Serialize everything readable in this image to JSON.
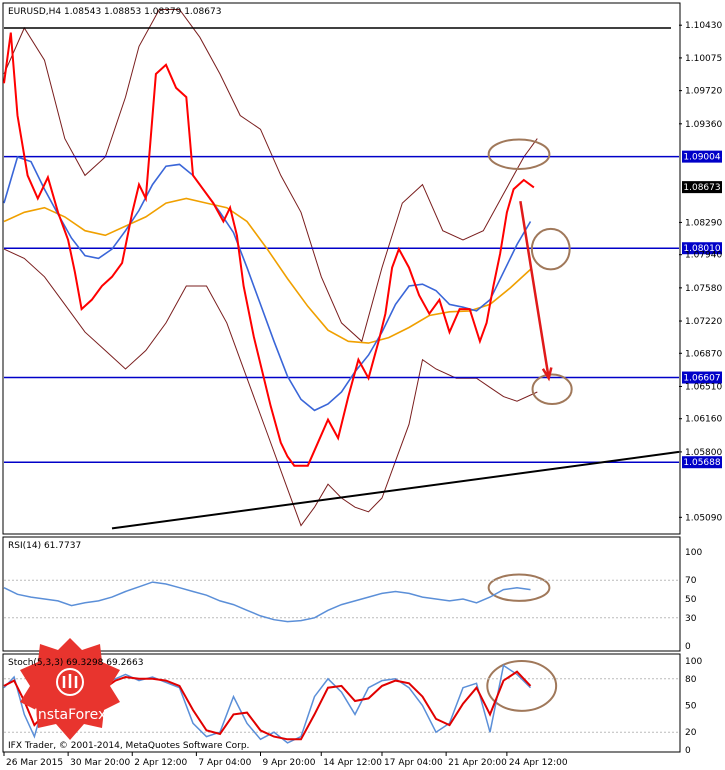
{
  "chart_data": {
    "type": "line",
    "colors": {
      "price": "#ff0000",
      "ma_fast": "#3a66d8",
      "ma_slow": "#f0a000",
      "bands": "#7a1e1e",
      "levels": "#0000c8",
      "trend": "#000000",
      "annotation_circle": "#a0785a",
      "annotation_arrow": "#e01a1a",
      "rsi": "#5b8fd8",
      "stoch_main": "#5b8fd8",
      "stoch_signal": "#e00000"
    },
    "main": {
      "header": "EURUSD,H4  1.08543 1.08853 1.08379 1.08673",
      "ylim": [
        1.0492,
        1.1066
      ],
      "y_ticks": [
        "1.10430",
        "1.10075",
        "1.09720",
        "1.09360",
        "1.08290",
        "1.07940",
        "1.07580",
        "1.07220",
        "1.06870",
        "1.06510",
        "1.06160",
        "1.05800",
        "1.05090"
      ],
      "levels": [
        {
          "value": 1.09004,
          "label": "1.09004"
        },
        {
          "value": 1.0801,
          "label": "1.08010"
        },
        {
          "value": 1.06607,
          "label": "1.06607"
        },
        {
          "value": 1.05688,
          "label": "1.05688"
        }
      ],
      "current_price": {
        "value": 1.08673,
        "label": "1.08673"
      },
      "top_line": 1.104,
      "trendline": [
        [
          0.16,
          1.0497
        ],
        [
          1.0,
          1.058
        ]
      ],
      "price": [
        [
          0.0,
          1.098
        ],
        [
          0.01,
          1.1035
        ],
        [
          0.02,
          1.0945
        ],
        [
          0.035,
          1.088
        ],
        [
          0.05,
          1.0855
        ],
        [
          0.065,
          1.0878
        ],
        [
          0.08,
          1.084
        ],
        [
          0.095,
          1.081
        ],
        [
          0.105,
          1.0775
        ],
        [
          0.115,
          1.0735
        ],
        [
          0.13,
          1.0745
        ],
        [
          0.145,
          1.076
        ],
        [
          0.16,
          1.077
        ],
        [
          0.175,
          1.0785
        ],
        [
          0.19,
          1.084
        ],
        [
          0.2,
          1.087
        ],
        [
          0.21,
          1.0855
        ],
        [
          0.225,
          1.099
        ],
        [
          0.24,
          1.1
        ],
        [
          0.255,
          1.0975
        ],
        [
          0.27,
          1.0965
        ],
        [
          0.28,
          1.088
        ],
        [
          0.295,
          1.0865
        ],
        [
          0.31,
          1.085
        ],
        [
          0.325,
          1.083
        ],
        [
          0.335,
          1.0845
        ],
        [
          0.345,
          1.0815
        ],
        [
          0.355,
          1.076
        ],
        [
          0.37,
          1.0705
        ],
        [
          0.385,
          1.066
        ],
        [
          0.395,
          1.063
        ],
        [
          0.41,
          1.059
        ],
        [
          0.42,
          1.0575
        ],
        [
          0.43,
          1.0565
        ],
        [
          0.45,
          1.0565
        ],
        [
          0.465,
          1.059
        ],
        [
          0.48,
          1.0615
        ],
        [
          0.495,
          1.0595
        ],
        [
          0.51,
          1.064
        ],
        [
          0.525,
          1.068
        ],
        [
          0.54,
          1.066
        ],
        [
          0.555,
          1.07
        ],
        [
          0.565,
          1.073
        ],
        [
          0.575,
          1.078
        ],
        [
          0.585,
          1.08
        ],
        [
          0.6,
          1.078
        ],
        [
          0.615,
          1.075
        ],
        [
          0.63,
          1.073
        ],
        [
          0.645,
          1.0745
        ],
        [
          0.66,
          1.071
        ],
        [
          0.675,
          1.0735
        ],
        [
          0.69,
          1.0735
        ],
        [
          0.705,
          1.07
        ],
        [
          0.715,
          1.072
        ],
        [
          0.725,
          1.076
        ],
        [
          0.735,
          1.0795
        ],
        [
          0.745,
          1.084
        ],
        [
          0.755,
          1.0865
        ],
        [
          0.77,
          1.0875
        ],
        [
          0.785,
          1.0867
        ]
      ],
      "ma_fast": [
        [
          0.0,
          1.085
        ],
        [
          0.02,
          1.09
        ],
        [
          0.04,
          1.0895
        ],
        [
          0.06,
          1.0865
        ],
        [
          0.08,
          1.0838
        ],
        [
          0.1,
          1.0812
        ],
        [
          0.12,
          1.0793
        ],
        [
          0.14,
          1.079
        ],
        [
          0.16,
          1.08
        ],
        [
          0.18,
          1.082
        ],
        [
          0.2,
          1.0842
        ],
        [
          0.22,
          1.087
        ],
        [
          0.24,
          1.089
        ],
        [
          0.26,
          1.0892
        ],
        [
          0.28,
          1.088
        ],
        [
          0.3,
          1.086
        ],
        [
          0.32,
          1.084
        ],
        [
          0.34,
          1.0818
        ],
        [
          0.36,
          1.078
        ],
        [
          0.38,
          1.074
        ],
        [
          0.4,
          1.07
        ],
        [
          0.42,
          1.0662
        ],
        [
          0.44,
          1.0637
        ],
        [
          0.46,
          1.0625
        ],
        [
          0.48,
          1.0632
        ],
        [
          0.5,
          1.0645
        ],
        [
          0.52,
          1.0667
        ],
        [
          0.54,
          1.0685
        ],
        [
          0.56,
          1.071
        ],
        [
          0.58,
          1.074
        ],
        [
          0.6,
          1.076
        ],
        [
          0.62,
          1.0762
        ],
        [
          0.64,
          1.0755
        ],
        [
          0.66,
          1.074
        ],
        [
          0.68,
          1.0737
        ],
        [
          0.7,
          1.0733
        ],
        [
          0.72,
          1.0745
        ],
        [
          0.74,
          1.0775
        ],
        [
          0.76,
          1.0805
        ],
        [
          0.78,
          1.083
        ]
      ],
      "ma_slow": [
        [
          0.0,
          1.083
        ],
        [
          0.03,
          1.084
        ],
        [
          0.06,
          1.0845
        ],
        [
          0.09,
          1.0835
        ],
        [
          0.12,
          1.082
        ],
        [
          0.15,
          1.0815
        ],
        [
          0.18,
          1.0825
        ],
        [
          0.21,
          1.0835
        ],
        [
          0.24,
          1.085
        ],
        [
          0.27,
          1.0855
        ],
        [
          0.3,
          1.085
        ],
        [
          0.33,
          1.0845
        ],
        [
          0.36,
          1.083
        ],
        [
          0.39,
          1.08
        ],
        [
          0.42,
          1.0768
        ],
        [
          0.45,
          1.0738
        ],
        [
          0.48,
          1.0712
        ],
        [
          0.51,
          1.07
        ],
        [
          0.54,
          1.0698
        ],
        [
          0.57,
          1.0704
        ],
        [
          0.6,
          1.0715
        ],
        [
          0.63,
          1.0728
        ],
        [
          0.66,
          1.0732
        ],
        [
          0.69,
          1.0733
        ],
        [
          0.72,
          1.074
        ],
        [
          0.75,
          1.0758
        ],
        [
          0.78,
          1.0778
        ]
      ],
      "band_upper": [
        [
          0.0,
          1.099
        ],
        [
          0.03,
          1.104
        ],
        [
          0.06,
          1.1005
        ],
        [
          0.09,
          1.092
        ],
        [
          0.12,
          1.088
        ],
        [
          0.15,
          1.09
        ],
        [
          0.18,
          1.0965
        ],
        [
          0.2,
          1.102
        ],
        [
          0.23,
          1.106
        ],
        [
          0.26,
          1.106
        ],
        [
          0.29,
          1.103
        ],
        [
          0.32,
          1.099
        ],
        [
          0.35,
          1.0945
        ],
        [
          0.38,
          1.093
        ],
        [
          0.41,
          1.088
        ],
        [
          0.44,
          1.084
        ],
        [
          0.47,
          1.077
        ],
        [
          0.5,
          1.072
        ],
        [
          0.53,
          1.07
        ],
        [
          0.56,
          1.078
        ],
        [
          0.59,
          1.085
        ],
        [
          0.62,
          1.087
        ],
        [
          0.65,
          1.082
        ],
        [
          0.68,
          1.081
        ],
        [
          0.71,
          1.082
        ],
        [
          0.74,
          1.086
        ],
        [
          0.77,
          1.09
        ],
        [
          0.79,
          1.092
        ]
      ],
      "band_lower": [
        [
          0.0,
          1.08
        ],
        [
          0.03,
          1.079
        ],
        [
          0.06,
          1.077
        ],
        [
          0.09,
          1.074
        ],
        [
          0.12,
          1.071
        ],
        [
          0.15,
          1.069
        ],
        [
          0.18,
          1.067
        ],
        [
          0.21,
          1.069
        ],
        [
          0.24,
          1.072
        ],
        [
          0.27,
          1.076
        ],
        [
          0.3,
          1.076
        ],
        [
          0.33,
          1.072
        ],
        [
          0.36,
          1.066
        ],
        [
          0.39,
          1.06
        ],
        [
          0.42,
          1.054
        ],
        [
          0.44,
          1.05
        ],
        [
          0.46,
          1.052
        ],
        [
          0.48,
          1.0545
        ],
        [
          0.5,
          1.053
        ],
        [
          0.52,
          1.052
        ],
        [
          0.54,
          1.0515
        ],
        [
          0.56,
          1.053
        ],
        [
          0.58,
          1.057
        ],
        [
          0.6,
          1.061
        ],
        [
          0.62,
          1.068
        ],
        [
          0.64,
          1.067
        ],
        [
          0.67,
          1.066
        ],
        [
          0.7,
          1.066
        ],
        [
          0.72,
          1.065
        ],
        [
          0.74,
          1.064
        ],
        [
          0.76,
          1.0635
        ],
        [
          0.79,
          1.0645
        ]
      ],
      "annotations": {
        "circles": [
          {
            "x": 0.763,
            "y": 1.0903,
            "rx": 0.045,
            "ry": 0.0016
          },
          {
            "x": 0.81,
            "y": 1.08,
            "rx": 0.028,
            "ry": 0.0022
          },
          {
            "x": 0.812,
            "y": 1.0648,
            "rx": 0.029,
            "ry": 0.0016
          }
        ],
        "arrow": [
          [
            0.765,
            1.0852
          ],
          [
            0.807,
            1.066
          ]
        ]
      }
    },
    "rsi": {
      "label": "RSI(14) 61.7737",
      "ylim": [
        0,
        100
      ],
      "y_ticks": [
        "100",
        "70",
        "50",
        "30",
        "0"
      ],
      "values": [
        [
          0.0,
          62
        ],
        [
          0.02,
          55
        ],
        [
          0.04,
          52
        ],
        [
          0.06,
          50
        ],
        [
          0.08,
          48
        ],
        [
          0.1,
          43
        ],
        [
          0.12,
          46
        ],
        [
          0.14,
          48
        ],
        [
          0.16,
          52
        ],
        [
          0.18,
          58
        ],
        [
          0.2,
          63
        ],
        [
          0.22,
          68
        ],
        [
          0.24,
          66
        ],
        [
          0.26,
          62
        ],
        [
          0.28,
          58
        ],
        [
          0.3,
          54
        ],
        [
          0.32,
          48
        ],
        [
          0.34,
          44
        ],
        [
          0.36,
          38
        ],
        [
          0.38,
          32
        ],
        [
          0.4,
          28
        ],
        [
          0.42,
          26
        ],
        [
          0.44,
          27
        ],
        [
          0.46,
          30
        ],
        [
          0.48,
          38
        ],
        [
          0.5,
          44
        ],
        [
          0.52,
          48
        ],
        [
          0.54,
          52
        ],
        [
          0.56,
          56
        ],
        [
          0.58,
          58
        ],
        [
          0.6,
          56
        ],
        [
          0.62,
          52
        ],
        [
          0.64,
          50
        ],
        [
          0.66,
          48
        ],
        [
          0.68,
          50
        ],
        [
          0.7,
          46
        ],
        [
          0.72,
          52
        ],
        [
          0.74,
          60
        ],
        [
          0.76,
          62
        ],
        [
          0.78,
          60
        ]
      ],
      "circle": {
        "x": 0.763,
        "y": 62,
        "rx": 0.045,
        "ry": 14
      }
    },
    "stoch": {
      "label": "Stoch(5,3,3) 69.3298 69.2663",
      "ylim": [
        0,
        100
      ],
      "y_ticks": [
        "100",
        "80",
        "50",
        "20",
        "0"
      ],
      "main": [
        [
          0.0,
          70
        ],
        [
          0.015,
          82
        ],
        [
          0.03,
          40
        ],
        [
          0.045,
          15
        ],
        [
          0.06,
          55
        ],
        [
          0.075,
          80
        ],
        [
          0.09,
          72
        ],
        [
          0.105,
          40
        ],
        [
          0.12,
          35
        ],
        [
          0.135,
          70
        ],
        [
          0.15,
          75
        ],
        [
          0.165,
          80
        ],
        [
          0.18,
          85
        ],
        [
          0.2,
          78
        ],
        [
          0.22,
          82
        ],
        [
          0.24,
          76
        ],
        [
          0.26,
          70
        ],
        [
          0.28,
          30
        ],
        [
          0.3,
          15
        ],
        [
          0.32,
          20
        ],
        [
          0.34,
          60
        ],
        [
          0.36,
          30
        ],
        [
          0.38,
          12
        ],
        [
          0.4,
          20
        ],
        [
          0.42,
          8
        ],
        [
          0.44,
          15
        ],
        [
          0.46,
          60
        ],
        [
          0.48,
          80
        ],
        [
          0.5,
          65
        ],
        [
          0.52,
          40
        ],
        [
          0.54,
          70
        ],
        [
          0.56,
          78
        ],
        [
          0.58,
          80
        ],
        [
          0.6,
          70
        ],
        [
          0.62,
          50
        ],
        [
          0.64,
          20
        ],
        [
          0.66,
          30
        ],
        [
          0.68,
          70
        ],
        [
          0.7,
          75
        ],
        [
          0.72,
          20
        ],
        [
          0.74,
          95
        ],
        [
          0.76,
          85
        ],
        [
          0.78,
          70
        ]
      ],
      "signal": [
        [
          0.0,
          72
        ],
        [
          0.015,
          78
        ],
        [
          0.03,
          55
        ],
        [
          0.045,
          28
        ],
        [
          0.06,
          40
        ],
        [
          0.075,
          68
        ],
        [
          0.09,
          75
        ],
        [
          0.105,
          55
        ],
        [
          0.12,
          40
        ],
        [
          0.135,
          55
        ],
        [
          0.15,
          70
        ],
        [
          0.165,
          78
        ],
        [
          0.18,
          82
        ],
        [
          0.2,
          80
        ],
        [
          0.22,
          80
        ],
        [
          0.24,
          78
        ],
        [
          0.26,
          72
        ],
        [
          0.28,
          45
        ],
        [
          0.3,
          22
        ],
        [
          0.32,
          18
        ],
        [
          0.34,
          40
        ],
        [
          0.36,
          42
        ],
        [
          0.38,
          22
        ],
        [
          0.4,
          15
        ],
        [
          0.42,
          12
        ],
        [
          0.44,
          12
        ],
        [
          0.46,
          40
        ],
        [
          0.48,
          70
        ],
        [
          0.5,
          72
        ],
        [
          0.52,
          55
        ],
        [
          0.54,
          58
        ],
        [
          0.56,
          72
        ],
        [
          0.58,
          78
        ],
        [
          0.6,
          75
        ],
        [
          0.62,
          60
        ],
        [
          0.64,
          35
        ],
        [
          0.66,
          28
        ],
        [
          0.68,
          52
        ],
        [
          0.7,
          70
        ],
        [
          0.72,
          40
        ],
        [
          0.74,
          78
        ],
        [
          0.76,
          88
        ],
        [
          0.78,
          72
        ]
      ],
      "circle": {
        "x": 0.767,
        "y": 72,
        "rx": 0.051,
        "ry": 28
      }
    },
    "x_ticks": [
      {
        "x": 0.0,
        "label": "26 Mar 2015"
      },
      {
        "x": 0.095,
        "label": "30 Mar 20:00"
      },
      {
        "x": 0.19,
        "label": "2 Apr 12:00"
      },
      {
        "x": 0.285,
        "label": "7 Apr 04:00"
      },
      {
        "x": 0.38,
        "label": "9 Apr 20:00"
      },
      {
        "x": 0.47,
        "label": "14 Apr 12:00"
      },
      {
        "x": 0.56,
        "label": "17 Apr 04:00"
      },
      {
        "x": 0.655,
        "label": "21 Apr 20:00"
      },
      {
        "x": 0.745,
        "label": "24 Apr 12:00"
      }
    ],
    "footer": "IFX Trader, © 2001-2014, MetaQuotes Software Corp.",
    "logo_text": "InstaForex"
  }
}
